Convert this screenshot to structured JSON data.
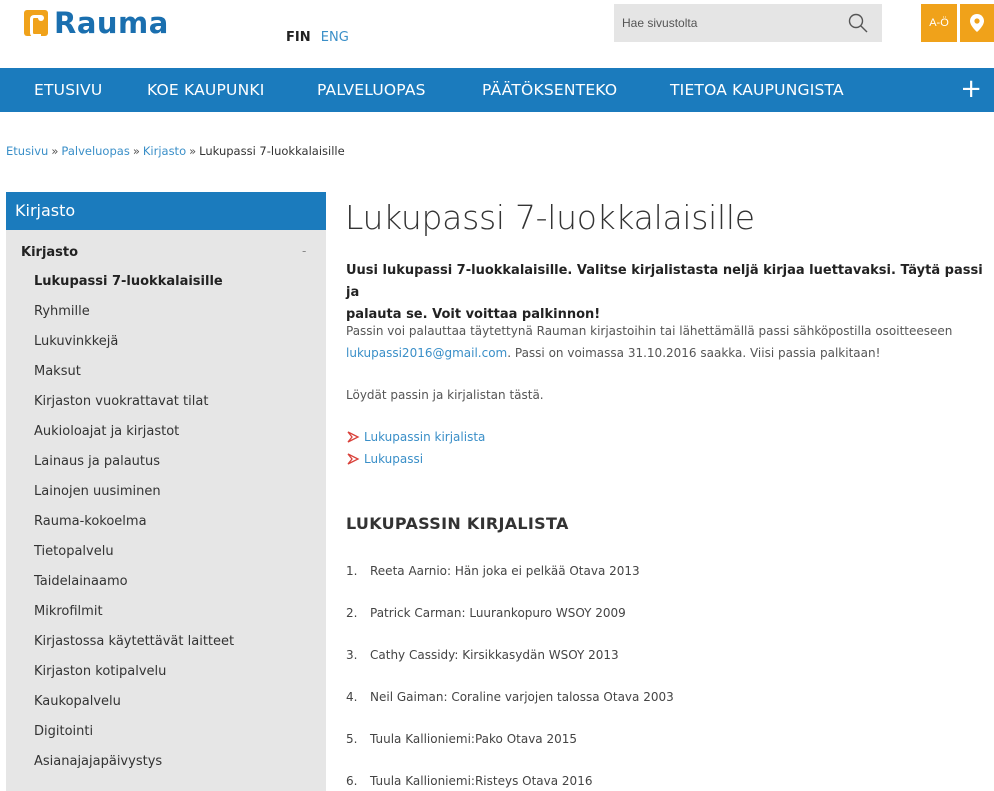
{
  "header": {
    "logo_text": "Rauma",
    "lang_fin": "FIN",
    "lang_eng": "ENG",
    "search_placeholder": "Hae sivustolta",
    "ao_label": "A-Ö",
    "accent_color": "#f0a21a",
    "brand_color": "#1b7bbd"
  },
  "nav": {
    "items": [
      "ETUSIVU",
      "KOE KAUPUNKI",
      "PALVELUOPAS",
      "PÄÄTÖKSENTEKO",
      "TIETOA KAUPUNGISTA"
    ],
    "plus": "+"
  },
  "breadcrumb": {
    "items": [
      "Etusivu",
      "Palveluopas",
      "Kirjasto"
    ],
    "sep": "»",
    "current": "Lukupassi 7-luokkalaisille"
  },
  "sidebar": {
    "title": "Kirjasto",
    "section": "Kirjasto",
    "dash": "-",
    "items": [
      "Lukupassi 7-luokkalaisille",
      "Ryhmille",
      "Lukuvinkkejä",
      "Maksut",
      "Kirjaston vuokrattavat tilat",
      "Aukioloajat ja kirjastot",
      "Lainaus ja palautus",
      "Lainojen uusiminen",
      "Rauma-kokoelma",
      "Tietopalvelu",
      "Taidelainaamo",
      "Mikrofilmit",
      "Kirjastossa käytettävät laitteet",
      "Kirjaston kotipalvelu",
      "Kaukopalvelu",
      "Digitointi",
      "Asianajajapäivystys"
    ]
  },
  "main": {
    "title": "Lukupassi 7-luokkalaisille",
    "lead_line1": "Uusi lukupassi 7-luokkalaisille.  Valitse kirjalistasta neljä kirjaa luettavaksi. Täytä passi ja",
    "lead_line2": "palauta se. Voit voittaa palkinnon!",
    "para1_line1": "Passin voi palauttaa täytettynä Rauman kirjastoihin tai lähettämällä passi sähköpostilla osoitteeseen",
    "para1_email": "lukupassi2016@gmail.com",
    "para1_rest": ". Passi on voimassa 31.10.2016 saakka. Viisi passia palkitaan!",
    "para2": "Löydät passin ja kirjalistan tästä.",
    "links": [
      "Lukupassin kirjalista",
      "Lukupassi"
    ],
    "subheading": "LUKUPASSIN KIRJALISTA",
    "books": [
      {
        "num": "1.",
        "text": "Reeta Aarnio: Hän joka ei pelkää Otava 2013"
      },
      {
        "num": "2.",
        "text": "Patrick Carman: Luurankopuro WSOY 2009"
      },
      {
        "num": "3.",
        "text": "Cathy Cassidy: Kirsikkasydän WSOY 2013"
      },
      {
        "num": "4.",
        "text": "Neil Gaiman: Coraline varjojen talossa Otava 2003"
      },
      {
        "num": "5.",
        "text": "Tuula Kallioniemi:Pako Otava 2015"
      },
      {
        "num": "6.",
        "text": "Tuula Kallioniemi:Risteys Otava 2016"
      }
    ]
  }
}
